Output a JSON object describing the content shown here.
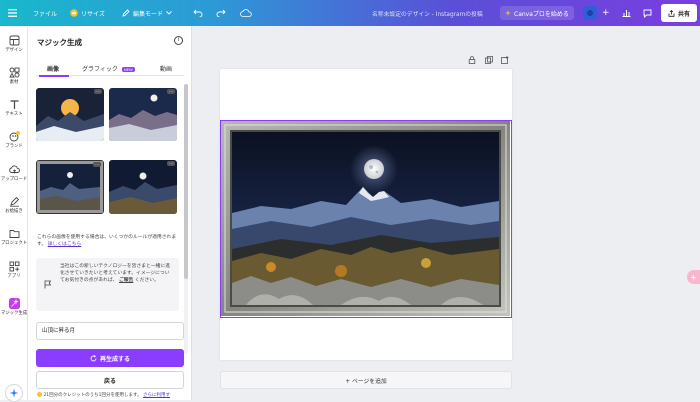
{
  "topbar": {
    "file_label": "ファイル",
    "resize_label": "リサイズ",
    "edit_mode_label": "編集モード",
    "doc_title": "名称未設定のデザイン - Instagramの投稿",
    "canva_pro_label": "Canvaプロを始める",
    "share_label": "共有"
  },
  "rail": [
    {
      "label": "デザイン",
      "icon": "layout-icon"
    },
    {
      "label": "素材",
      "icon": "elements-icon"
    },
    {
      "label": "テキスト",
      "icon": "text-icon"
    },
    {
      "label": "ブランド",
      "icon": "brand-icon"
    },
    {
      "label": "アップロード",
      "icon": "upload-icon"
    },
    {
      "label": "お絵描き",
      "icon": "draw-icon"
    },
    {
      "label": "プロジェクト",
      "icon": "folder-icon"
    },
    {
      "label": "アプリ",
      "icon": "apps-icon"
    },
    {
      "label": "マジック生成",
      "icon": "magic-icon"
    }
  ],
  "panel": {
    "title": "マジック生成",
    "tabs": {
      "images": "画像",
      "graphics": "グラフィック",
      "graphics_badge": "NEW",
      "video": "動画"
    },
    "info_text": "これらの画像を使用する場合は、いくつかのルールが適用されます。",
    "info_link": "詳しくはこちら",
    "feedback_text": "当社はこの新しいテクノロジーを皆さまと一緒に進化させていきたいと考えています。イメージについてお気付きの点があれば、",
    "feedback_link": "ご報告",
    "feedback_tail": "ください。",
    "prompt_value": "山頂に昇る月",
    "regenerate_label": "再生成する",
    "back_label": "戻る",
    "credits_text": "21回分のクレジットのうち1回分を使用します。",
    "credits_link": "さらに利用す"
  },
  "canvas": {
    "add_page_label": "+ ページを追加"
  },
  "colors": {
    "accent": "#8b3dff",
    "topbar_start": "#19b8cc",
    "topbar_end": "#7a3ee0"
  }
}
